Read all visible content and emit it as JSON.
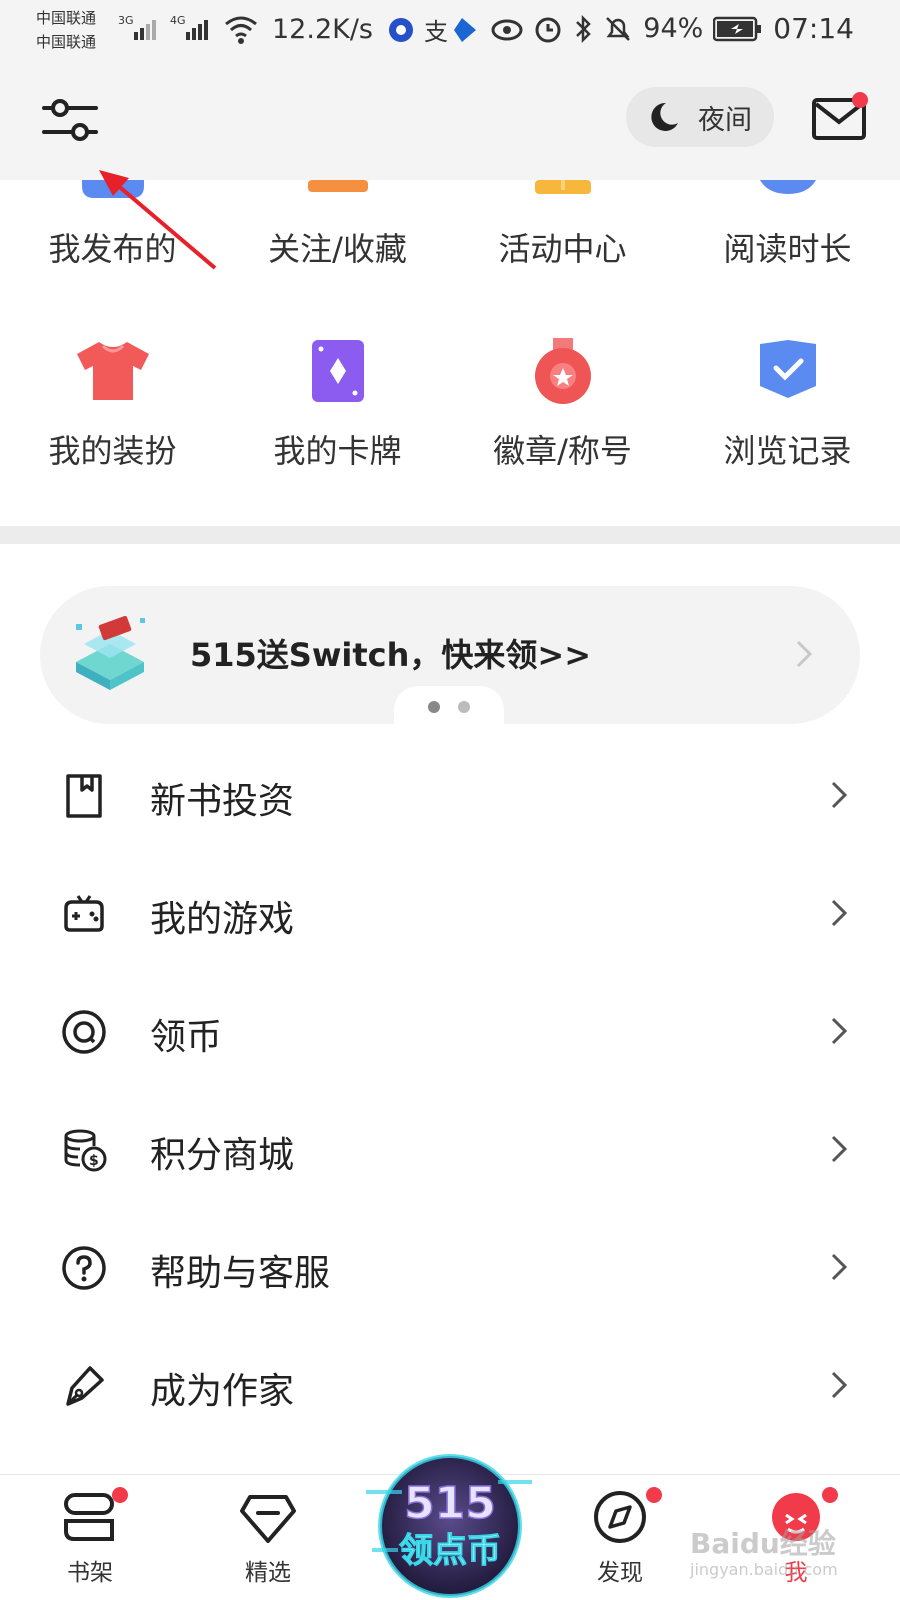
{
  "status_bar": {
    "carrier_1": "中国联通",
    "carrier_2": "中国联通",
    "net_1": "3G",
    "net_2": "4G",
    "speed": "12.2K/s",
    "battery": "94%",
    "time": "07:14"
  },
  "header": {
    "night_label": "夜间"
  },
  "grid": {
    "row1": [
      {
        "label": "我发布的",
        "icon": "publish-icon",
        "color": "#5b8af0"
      },
      {
        "label": "关注/收藏",
        "icon": "follow-icon",
        "color": "#f59040"
      },
      {
        "label": "活动中心",
        "icon": "activity-icon",
        "color": "#f6b73c"
      },
      {
        "label": "阅读时长",
        "icon": "reading-time-icon",
        "color": "#5b8af0"
      }
    ],
    "row2": [
      {
        "label": "我的装扮",
        "icon": "tshirt-icon",
        "color": "#f25a5a"
      },
      {
        "label": "我的卡牌",
        "icon": "card-icon",
        "color": "#8c5cf0"
      },
      {
        "label": "徽章/称号",
        "icon": "badge-icon",
        "color": "#f05555"
      },
      {
        "label": "浏览记录",
        "icon": "history-icon",
        "color": "#5b8af0"
      }
    ]
  },
  "banner": {
    "text": "515送Switch，快来领>>",
    "dots_total": 2,
    "dots_active": 1
  },
  "menu": [
    {
      "label": "新书投资",
      "icon": "bookmark-icon"
    },
    {
      "label": "我的游戏",
      "icon": "gamepad-icon"
    },
    {
      "label": "领币",
      "icon": "coin-icon"
    },
    {
      "label": "积分商城",
      "icon": "points-store-icon"
    },
    {
      "label": "帮助与客服",
      "icon": "help-icon"
    },
    {
      "label": "成为作家",
      "icon": "pen-icon"
    }
  ],
  "bottom_nav": {
    "items": [
      {
        "label": "书架",
        "icon": "bookshelf-icon",
        "badge": true
      },
      {
        "label": "精选",
        "icon": "diamond-icon",
        "badge": false
      },
      {
        "label": "发现",
        "icon": "compass-icon",
        "badge": true
      },
      {
        "label": "我",
        "icon": "me-icon",
        "badge": true
      }
    ],
    "promo_line1": "515",
    "promo_line2": "领点币"
  },
  "watermark": {
    "main": "Baidu经验",
    "sub": "jingyan.baidu.com"
  },
  "colors": {
    "accent_red": "#f23b4a",
    "header_bg": "#f4f4f4",
    "divider": "#ececec"
  }
}
